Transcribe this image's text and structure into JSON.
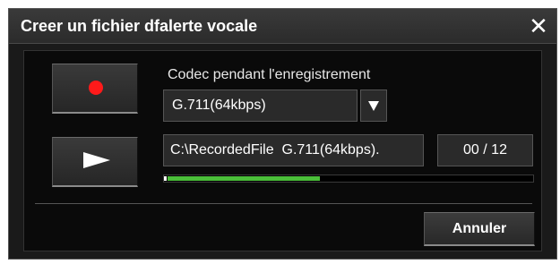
{
  "dialog": {
    "title": "Creer un fichier dfalerte vocale",
    "close_symbol": "✕"
  },
  "recording": {
    "codec_label": "Codec pendant l'enregistrement",
    "codec_value": "G.711(64kbps)",
    "file_value": "C:\\RecordedFile  G.711(64kbps).",
    "counter": "00 / 12",
    "progress_fraction": 0.42
  },
  "buttons": {
    "cancel_label": "Annuler"
  },
  "icons": {
    "record": "record-icon",
    "play": "play-icon",
    "dropdown": "dropdown-arrow-icon",
    "close": "close-icon"
  },
  "colors": {
    "record_dot": "#ff1a1a",
    "progress_fill": "#4bbf3a",
    "background": "#1a1a1a"
  }
}
